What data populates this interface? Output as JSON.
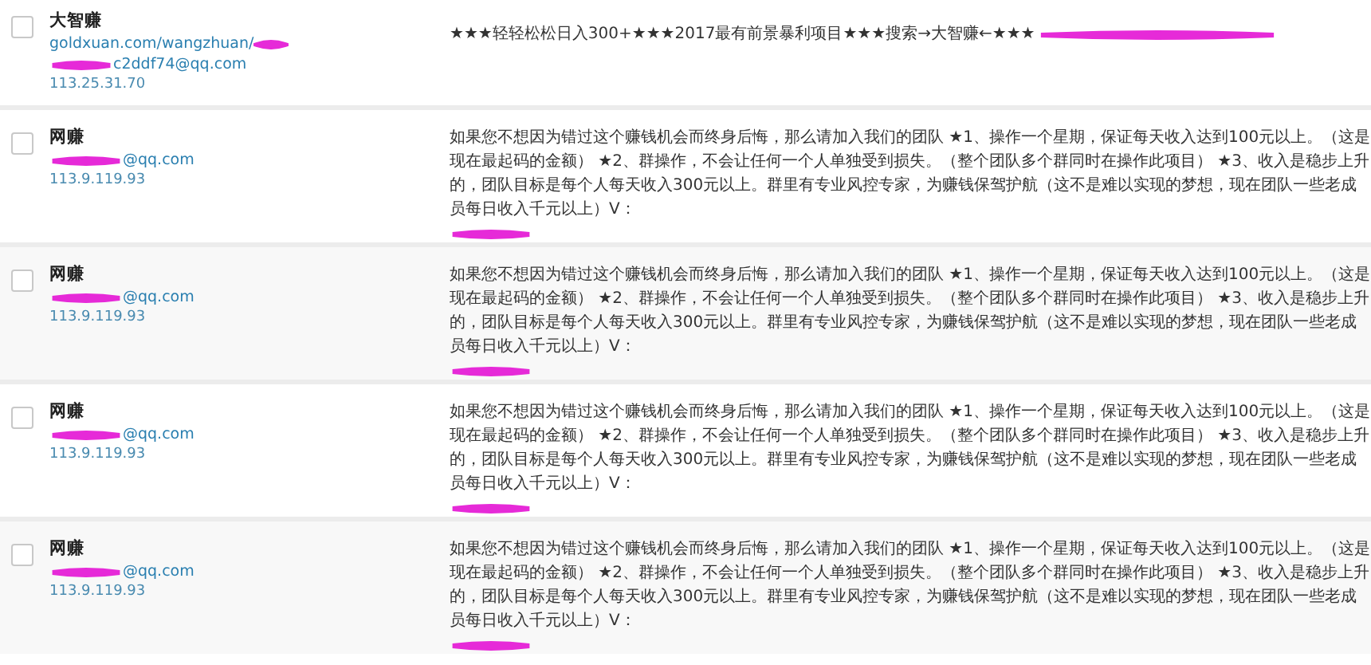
{
  "comments": [
    {
      "checked": false,
      "author": "大智赚",
      "url": "goldxuan.com/wangzhuan/",
      "email": "c2ddf74@qq.com",
      "ip": "113.25.31.70",
      "body": "★★★轻轻松松日入300+★★★2017最有前景暴利项目★★★搜索→大智赚←★★★"
    },
    {
      "checked": false,
      "author": "网赚",
      "email": "@qq.com",
      "ip": "113.9.119.93",
      "body": "如果您不想因为错过这个赚钱机会而终身后悔，那么请加入我们的团队 ★1、操作一个星期，保证每天收入达到100元以上。（这是现在最起码的金额） ★2、群操作，不会让任何一个人单独受到损失。（整个团队多个群同时在操作此项目） ★3、收入是稳步上升的，团队目标是每个人每天收入300元以上。群里有专业风控专家，为赚钱保驾护航（这不是难以实现的梦想，现在团队一些老成员每日收入千元以上）V："
    },
    {
      "checked": false,
      "author": "网赚",
      "email": "@qq.com",
      "ip": "113.9.119.93",
      "body": "如果您不想因为错过这个赚钱机会而终身后悔，那么请加入我们的团队 ★1、操作一个星期，保证每天收入达到100元以上。（这是现在最起码的金额） ★2、群操作，不会让任何一个人单独受到损失。（整个团队多个群同时在操作此项目） ★3、收入是稳步上升的，团队目标是每个人每天收入300元以上。群里有专业风控专家，为赚钱保驾护航（这不是难以实现的梦想，现在团队一些老成员每日收入千元以上）V："
    },
    {
      "checked": false,
      "author": "网赚",
      "email": "@qq.com",
      "ip": "113.9.119.93",
      "body": "如果您不想因为错过这个赚钱机会而终身后悔，那么请加入我们的团队 ★1、操作一个星期，保证每天收入达到100元以上。（这是现在最起码的金额） ★2、群操作，不会让任何一个人单独受到损失。（整个团队多个群同时在操作此项目） ★3、收入是稳步上升的，团队目标是每个人每天收入300元以上。群里有专业风控专家，为赚钱保驾护航（这不是难以实现的梦想，现在团队一些老成员每日收入千元以上）V："
    },
    {
      "checked": false,
      "author": "网赚",
      "email": "@qq.com",
      "ip": "113.9.119.93",
      "body": "如果您不想因为错过这个赚钱机会而终身后悔，那么请加入我们的团队 ★1、操作一个星期，保证每天收入达到100元以上。（这是现在最起码的金额） ★2、群操作，不会让任何一个人单独受到损失。（整个团队多个群同时在操作此项目） ★3、收入是稳步上升的，团队目标是每个人每天收入300元以上。群里有专业风控专家，为赚钱保驾护航（这不是难以实现的梦想，现在团队一些老成员每日收入千元以上）V："
    }
  ]
}
